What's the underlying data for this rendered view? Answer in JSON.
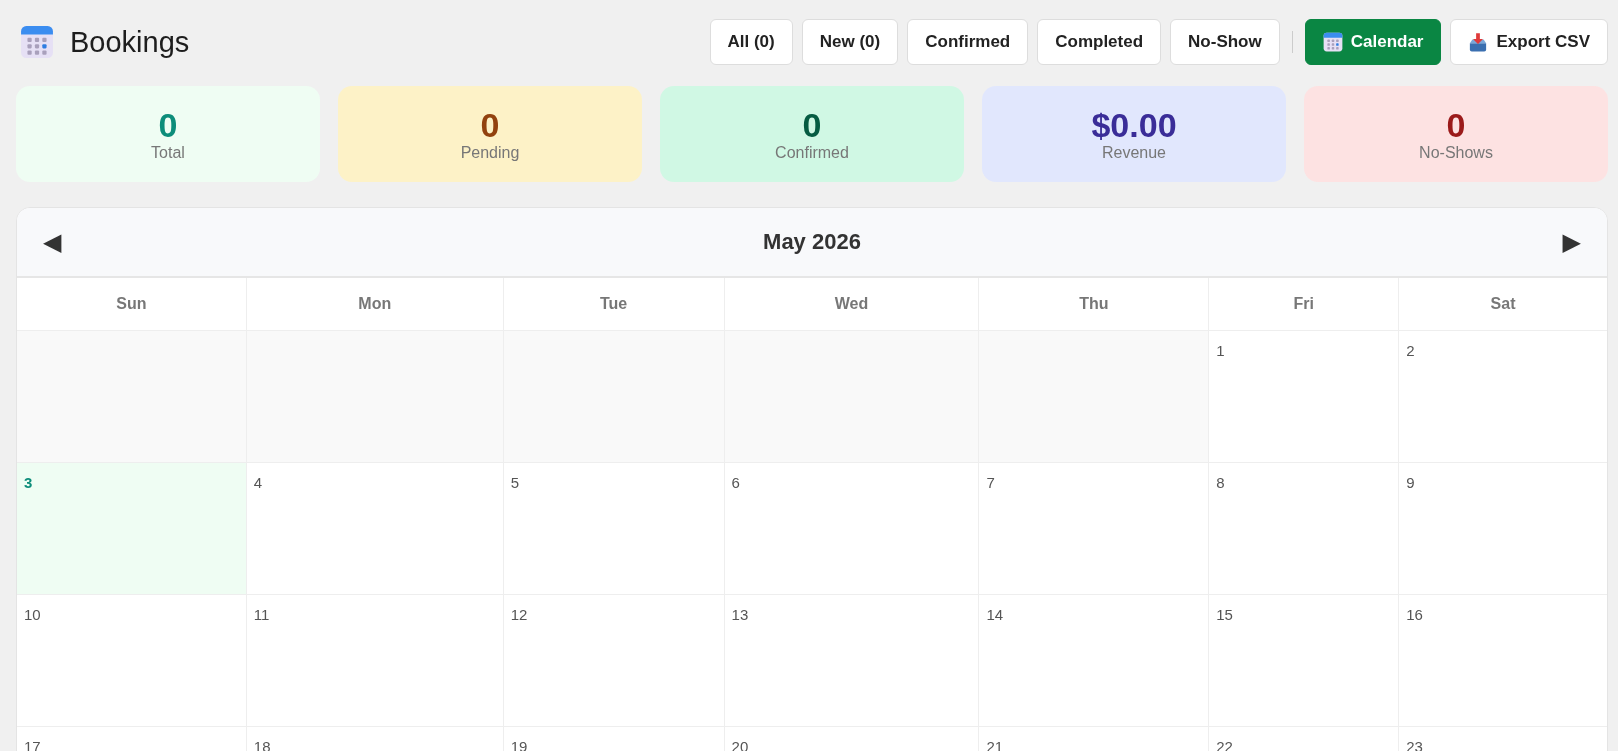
{
  "header": {
    "title": "Bookings"
  },
  "toolbar": {
    "filters": [
      {
        "label": "All (0)",
        "selected": false
      },
      {
        "label": "New (0)",
        "selected": false
      },
      {
        "label": "Confirmed",
        "selected": false
      },
      {
        "label": "Completed",
        "selected": false
      },
      {
        "label": "No-Show",
        "selected": false
      }
    ],
    "views": [
      {
        "label": "Calendar",
        "selected": true
      }
    ],
    "export": {
      "label": "Export CSV"
    }
  },
  "stats": [
    {
      "kind": "total",
      "value": "0",
      "label": "Total"
    },
    {
      "kind": "pending",
      "value": "0",
      "label": "Pending"
    },
    {
      "kind": "confirmed",
      "value": "0",
      "label": "Confirmed"
    },
    {
      "kind": "revenue",
      "value": "$0.00",
      "label": "Revenue"
    },
    {
      "kind": "noshow",
      "value": "0",
      "label": "No-Shows"
    }
  ],
  "calendar": {
    "month": "May 2026",
    "prev": "◀",
    "next": "▶",
    "weekdays": [
      "Sun",
      "Mon",
      "Tue",
      "Wed",
      "Thu",
      "Fri",
      "Sat"
    ],
    "weeks": [
      [
        {
          "kind": "blank"
        },
        {
          "kind": "blank"
        },
        {
          "kind": "blank"
        },
        {
          "kind": "blank"
        },
        {
          "kind": "blank"
        },
        {
          "kind": "day",
          "day": "1",
          "today": false
        },
        {
          "kind": "day",
          "day": "2",
          "today": false
        }
      ],
      [
        {
          "kind": "day",
          "day": "3",
          "today": true
        },
        {
          "kind": "day",
          "day": "4",
          "today": false
        },
        {
          "kind": "day",
          "day": "5",
          "today": false
        },
        {
          "kind": "day",
          "day": "6",
          "today": false
        },
        {
          "kind": "day",
          "day": "7",
          "today": false
        },
        {
          "kind": "day",
          "day": "8",
          "today": false
        },
        {
          "kind": "day",
          "day": "9",
          "today": false
        }
      ],
      [
        {
          "kind": "day",
          "day": "10",
          "today": false
        },
        {
          "kind": "day",
          "day": "11",
          "today": false
        },
        {
          "kind": "day",
          "day": "12",
          "today": false
        },
        {
          "kind": "day",
          "day": "13",
          "today": false
        },
        {
          "kind": "day",
          "day": "14",
          "today": false
        },
        {
          "kind": "day",
          "day": "15",
          "today": false
        },
        {
          "kind": "day",
          "day": "16",
          "today": false
        }
      ],
      [
        {
          "kind": "day",
          "day": "17",
          "today": false
        },
        {
          "kind": "day",
          "day": "18",
          "today": false
        },
        {
          "kind": "day",
          "day": "19",
          "today": false
        },
        {
          "kind": "day",
          "day": "20",
          "today": false
        },
        {
          "kind": "day",
          "day": "21",
          "today": false
        },
        {
          "kind": "day",
          "day": "22",
          "today": false
        },
        {
          "kind": "day",
          "day": "23",
          "today": false
        }
      ]
    ]
  }
}
